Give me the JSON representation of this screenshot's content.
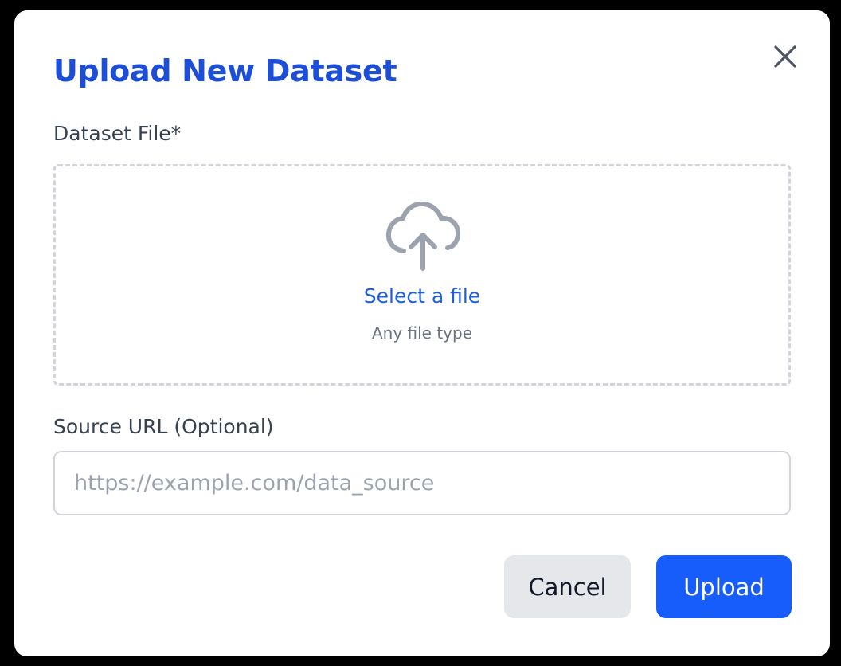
{
  "dialog": {
    "title": "Upload New Dataset",
    "close_icon": "close-icon",
    "file_field": {
      "label": "Dataset File*",
      "icon": "cloud-upload-icon",
      "select_label": "Select a file",
      "hint": "Any file type"
    },
    "url_field": {
      "label": "Source URL (Optional)",
      "value": "",
      "placeholder": "https://example.com/data_source"
    },
    "actions": {
      "cancel_label": "Cancel",
      "upload_label": "Upload"
    }
  },
  "colors": {
    "title": "#1d4ed8",
    "link": "#1d5fe0",
    "primary_button": "#165dfc",
    "secondary_button": "#e5e7eb",
    "backdrop": "#000000"
  }
}
